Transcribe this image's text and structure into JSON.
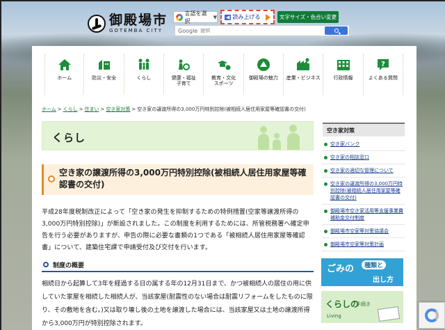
{
  "header": {
    "logo_jp": "御殿場市",
    "logo_en": "GOTEMBA CITY",
    "lang_select_label": "言語を選択",
    "readaloud_label": "読み上げる",
    "font_color_button": "文字サイズ・色合い変更",
    "search_brand": "Google",
    "search_placeholder": "提供"
  },
  "nav": [
    {
      "label": "ホーム",
      "icon": "home-icon"
    },
    {
      "label": "防災・安全",
      "icon": "disaster-safety-icon"
    },
    {
      "label": "くらし",
      "icon": "family-icon"
    },
    {
      "label": "健康・福祉\n子育て",
      "icon": "health-welfare-icon"
    },
    {
      "label": "教育・文化\nスポーツ",
      "icon": "education-culture-icon"
    },
    {
      "label": "御殿場の魅力",
      "icon": "attraction-icon"
    },
    {
      "label": "産業・ビジネス",
      "icon": "business-icon"
    },
    {
      "label": "行政情報",
      "icon": "government-icon"
    },
    {
      "label": "よくある質問",
      "icon": "faq-icon"
    }
  ],
  "breadcrumb": {
    "items": [
      "ホーム",
      "くらし",
      "住まい",
      "空き家対策"
    ],
    "current": "空き家の譲渡所得の3,000万円特別控除(被相続人居住用家屋等確認書の交付)"
  },
  "section_banner": "くらし",
  "page_title": "空き家の譲渡所得の3,000万円特別控除(被相続人居住用家屋等確認書の交付)",
  "intro_text": "平成28年度税制改正によって「空き家の発生を抑制するための特例措置(空家等譲渡所得の3,000万円特別控除)」が新設されました。この制度を利用するためには、所管税務署へ確定申告を行う必要がありますが、申告の際に必要な書類の1つである「被相続人居住用家屋等確認書」について、建築住宅課で申請受付及び交付を行います。",
  "subheading": "制度の概要",
  "overview_text": "相続日から起算して3年を経過する日の属する年の12月31日まで、かつ被相続人の居住の用に供していた家屋を相続した相続人が、当該家屋(耐震性のない場合は耐震リフォームをしたものに限り、その敷地を含む。)又は取り壊し後の土地を譲渡した場合には、当該家屋又は土地の譲渡所得から3,000万円が特別控除されます。",
  "sidebar": {
    "title": "空き家対策",
    "links": [
      "空き家バンク",
      "空き家の相談窓口",
      "空き家の適切な管理について",
      "空き家の譲渡所得の3,000万円特別控除(被相続人居住用家屋等確認書の交付)",
      "御殿場市空き家活用等支援事業費補助金交付制度",
      "御殿場市空家等対策協議会",
      "御殿場市空家等対策計画"
    ]
  },
  "banners": {
    "gomi_top": "ごみの",
    "gomi_shurui": "種類と",
    "gomi_bottom": "出し方",
    "kurashi_title": "くらしの",
    "kurashi_sub": "手続き",
    "kurashi_en": "Living"
  },
  "colors": {
    "accent_green": "#127b3a",
    "link_blue": "#1a3d8a",
    "heading_orange": "#e38a2a",
    "subheading_blue": "#2456a6"
  }
}
